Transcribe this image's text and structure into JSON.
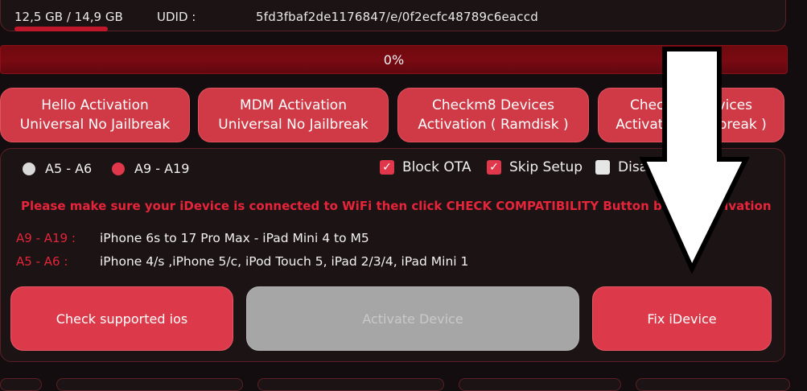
{
  "device": {
    "storage_text": "12,5 GB / 14,9 GB",
    "udid_label": "UDID :",
    "udid_value": "5fd3fbaf2de1176847/e/0f2ecfc48789c6eaccd"
  },
  "progress": {
    "percent_text": "0%",
    "value": 0
  },
  "modes": [
    {
      "line1": "Hello Activation",
      "line2": "Universal No Jailbreak"
    },
    {
      "line1": "MDM Activation",
      "line2": "Universal No Jailbreak"
    },
    {
      "line1": "Checkm8 Devices",
      "line2": "Activation ( Ramdisk )"
    },
    {
      "line1": "Checkm8 Devices",
      "line2": "Activation ( Jailbreak )"
    }
  ],
  "options": {
    "radio_a5": "A5 - A6",
    "radio_a9": "A9 - A19",
    "block_ota": "Block OTA",
    "skip_setup": "Skip Setup",
    "disable_reset": "Disable Reset"
  },
  "warning": "Please make sure your iDevice is connected to WiFi then click CHECK COMPATIBILITY Button before Activation",
  "ranges": [
    {
      "label": "A9 - A19 :",
      "desc": "iPhone 6s to 17 Pro Max - iPad Mini 4 to M5"
    },
    {
      "label": "A5 - A6 :",
      "desc": "iPhone 4/s ,iPhone 5/c, iPod Touch 5, iPad 2/3/4, iPad Mini 1"
    }
  ],
  "actions": {
    "check_label": "Check supported ios",
    "activate_label": "Activate Device",
    "fix_label": "Fix iDevice"
  },
  "colors": {
    "accent_red": "#dc3a4a",
    "warning_red": "#e6243a",
    "panel_bg": "#1c1315",
    "disabled_gray": "#a6a6a6"
  }
}
